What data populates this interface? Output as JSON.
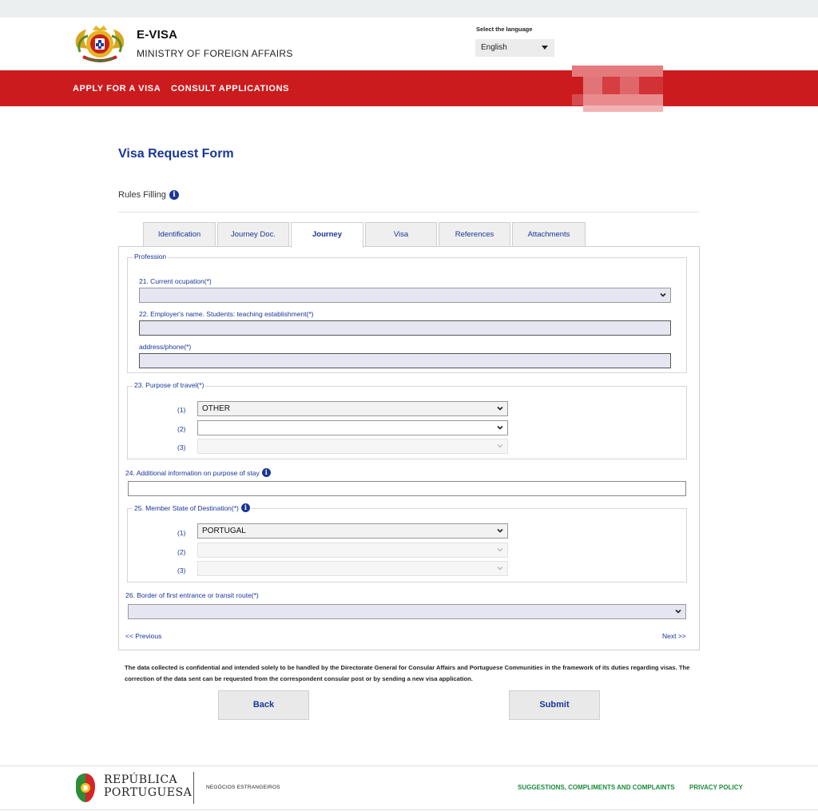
{
  "header": {
    "brand_title": "E-VISA",
    "brand_subtitle": "MINISTRY OF FOREIGN AFFAIRS",
    "language_label": "Select the language",
    "language_value": "English"
  },
  "nav": {
    "apply": "APPLY FOR A VISA",
    "consult": "CONSULT APPLICATIONS"
  },
  "page": {
    "title": "Visa Request Form",
    "rules_label": "Rules Filling"
  },
  "tabs": [
    {
      "label": "Identification",
      "active": false
    },
    {
      "label": "Journey Doc.",
      "active": false
    },
    {
      "label": "Journey",
      "active": true
    },
    {
      "label": "Visa",
      "active": false
    },
    {
      "label": "References",
      "active": false
    },
    {
      "label": "Attachments",
      "active": false
    }
  ],
  "profession": {
    "legend": "Profession",
    "ocupation_label": "21. Current ocupation(*)",
    "ocupation_value": "",
    "employer_label": "22. Employer's name. Students: teaching establishment(*)",
    "employer_value": "",
    "address_label": "address/phone(*)",
    "address_value": ""
  },
  "purpose": {
    "legend": "23. Purpose of travel(*)",
    "items": [
      {
        "index": "(1)",
        "value": "OTHER"
      },
      {
        "index": "(2)",
        "value": ""
      },
      {
        "index": "(3)",
        "value": ""
      }
    ]
  },
  "additional": {
    "label": "24. Additional information on purpose of stay",
    "value": ""
  },
  "destination": {
    "legend": "25. Member State of Destination(*)",
    "items": [
      {
        "index": "(1)",
        "value": "PORTUGAL"
      },
      {
        "index": "(2)",
        "value": ""
      },
      {
        "index": "(3)",
        "value": ""
      }
    ]
  },
  "border": {
    "label": "26. Border of first entrance or transit route(*)",
    "value": ""
  },
  "pager": {
    "previous": "<< Previous",
    "next": "Next >>"
  },
  "notice": "The data collected is confidential and intended solely to be handled by the Directorate General for Consular Affairs and Portuguese Communities in the framework of its duties regarding visas. The correction of the data sent can be requested from the correspondent consular post or by sending a new visa application.",
  "buttons": {
    "back": "Back",
    "submit": "Submit"
  },
  "footer": {
    "republica_line1": "REPÚBLICA",
    "republica_line2": "PORTUGUESA",
    "ministry": "NEGÓCIOS ESTRANGEIROS",
    "suggestions": "SUGGESTIONS, COMPLIMENTS AND COMPLAINTS",
    "privacy": "PRIVACY POLICY"
  },
  "colors": {
    "brand_red": "#cc1b1e",
    "link_blue": "#1a3697",
    "footer_green": "#1d8a3a"
  }
}
